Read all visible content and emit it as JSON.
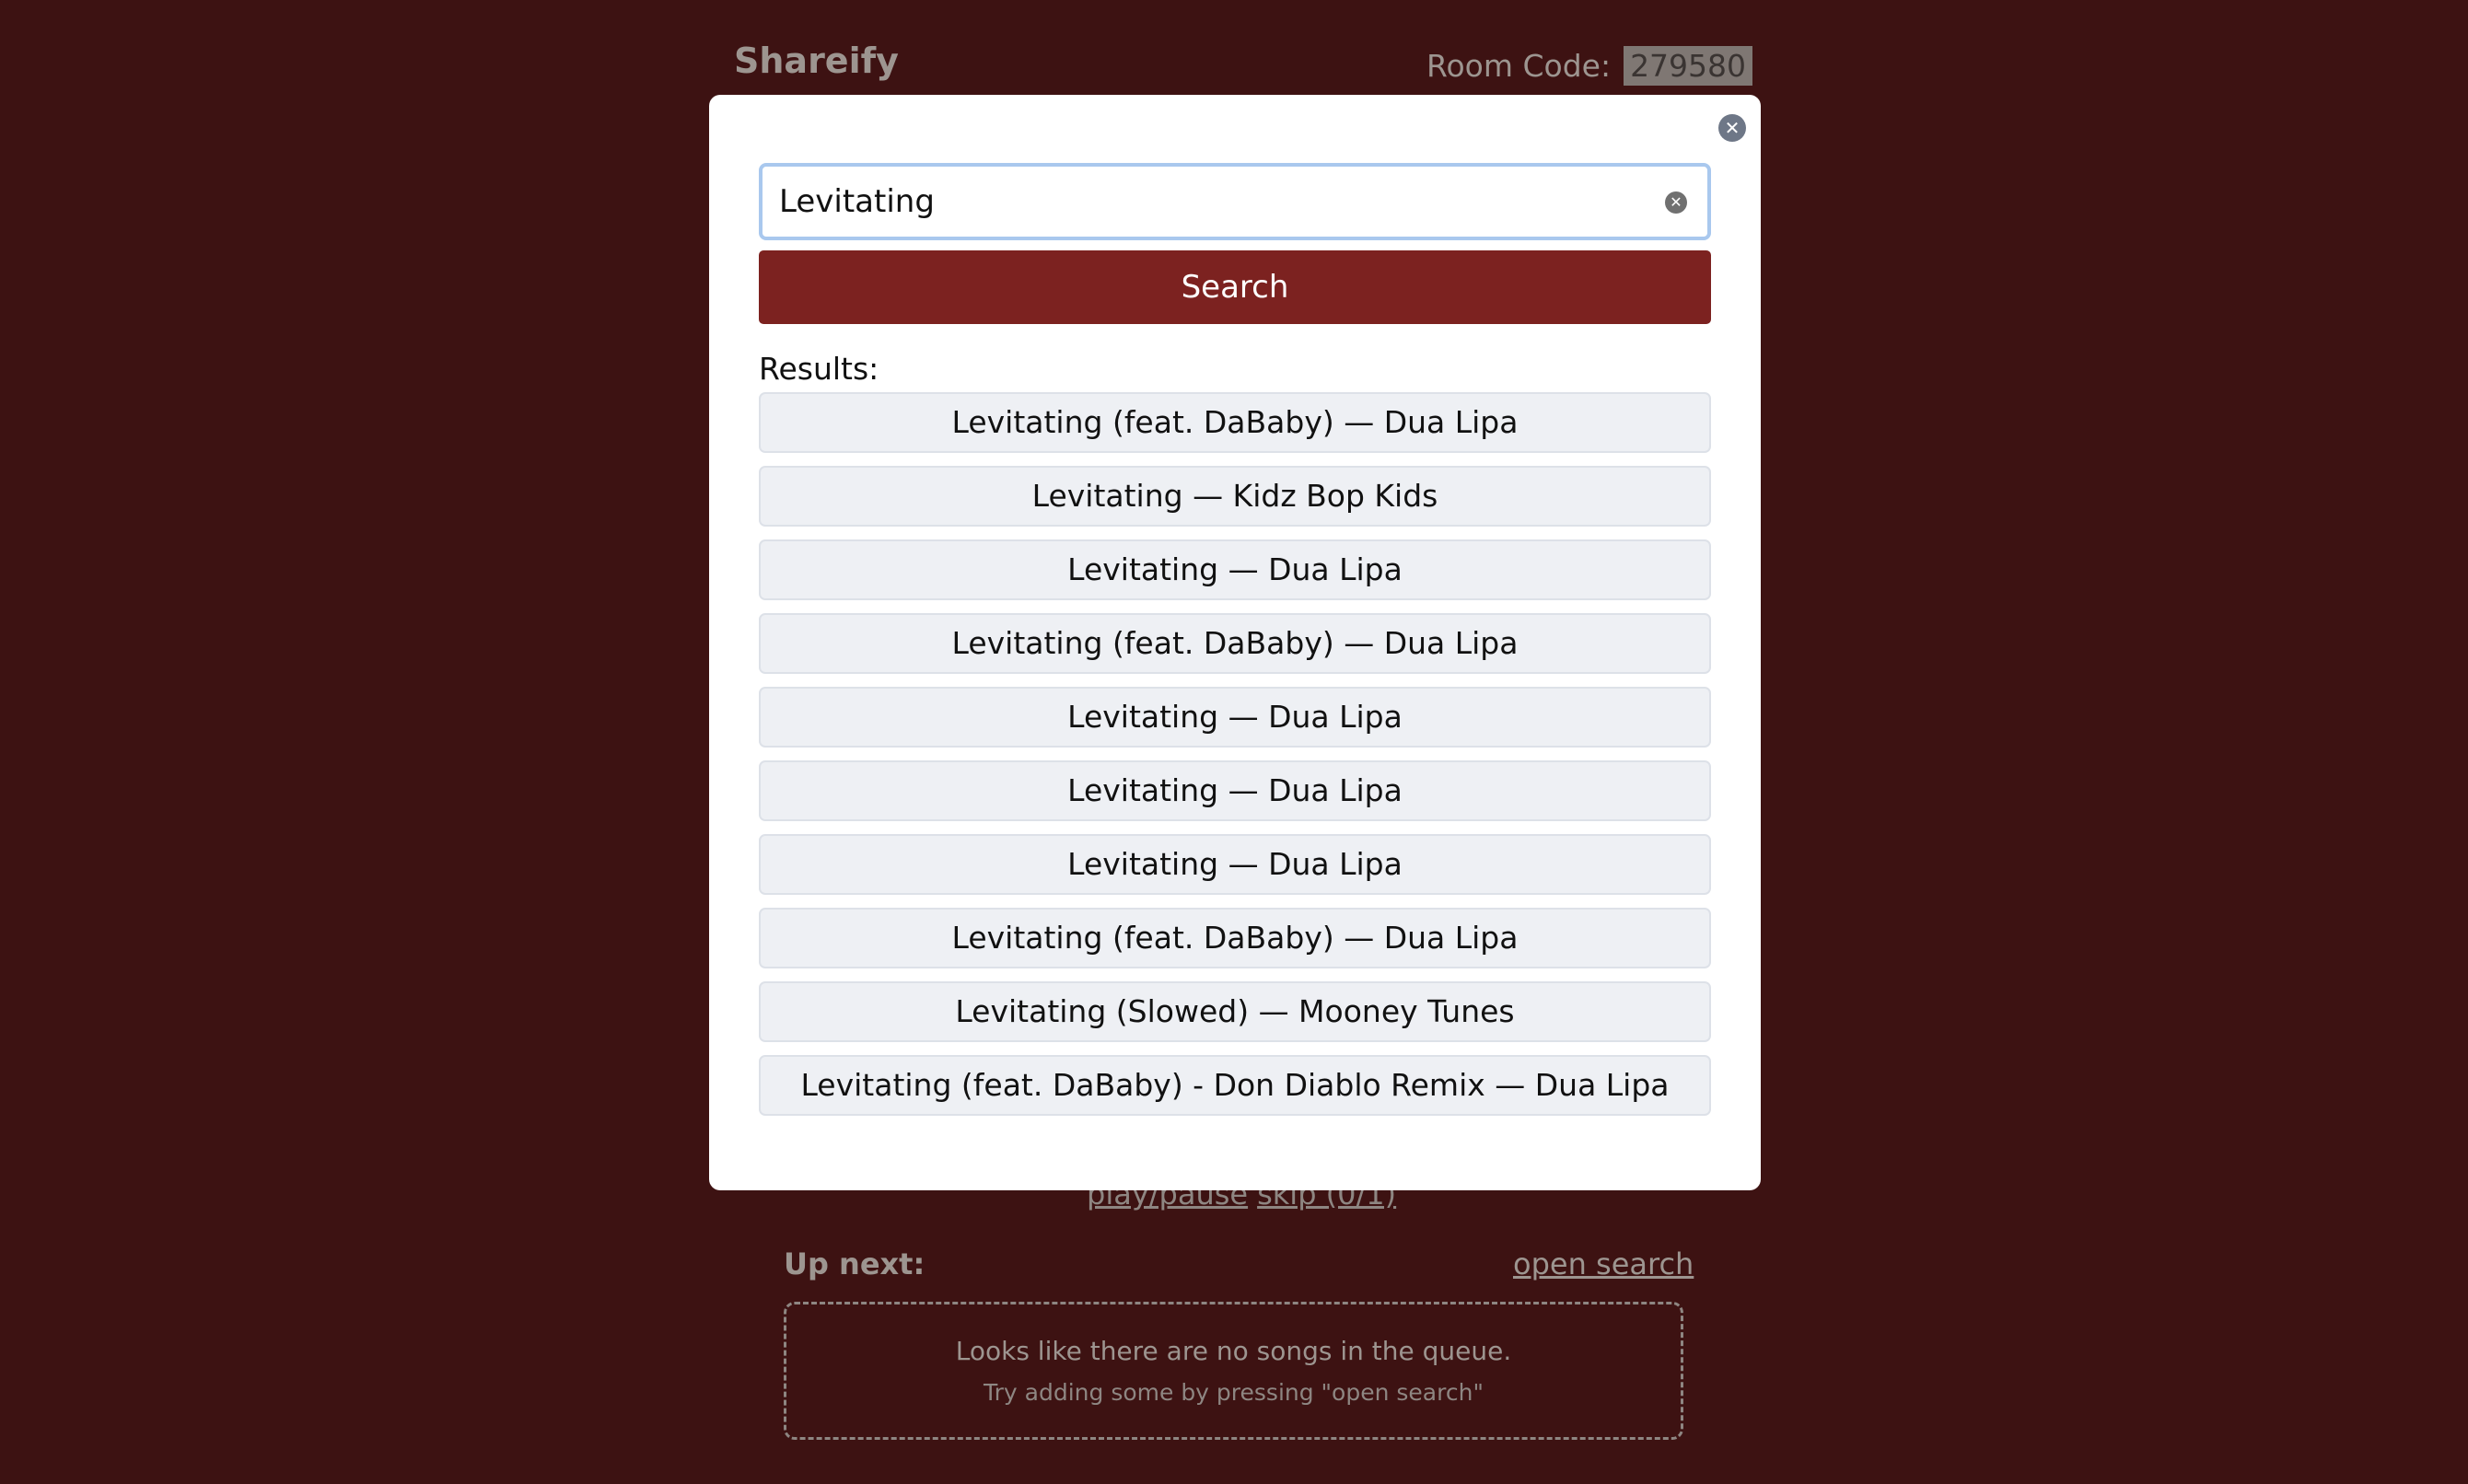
{
  "header": {
    "app_title": "Shareify",
    "room_code_label": "Room Code:",
    "room_code": "279580"
  },
  "player": {
    "play_pause": "play/pause",
    "skip": "skip (0/1)"
  },
  "queue": {
    "up_next_label": "Up next:",
    "open_search": "open search",
    "empty_message": "Looks like there are no songs in the queue.",
    "empty_hint": "Try adding some by pressing \"open search\""
  },
  "modal": {
    "close_icon": "close-icon",
    "search": {
      "value": "Levitating",
      "clear_icon": "clear-icon"
    },
    "search_button": "Search",
    "results_label": "Results:",
    "results": [
      "Levitating (feat. DaBaby) — Dua Lipa",
      "Levitating — Kidz Bop Kids",
      "Levitating — Dua Lipa",
      "Levitating (feat. DaBaby) — Dua Lipa",
      "Levitating — Dua Lipa",
      "Levitating — Dua Lipa",
      "Levitating — Dua Lipa",
      "Levitating (feat. DaBaby) — Dua Lipa",
      "Levitating (Slowed) — Mooney Tunes",
      "Levitating (feat. DaBaby) - Don Diablo Remix — Dua Lipa"
    ]
  },
  "colors": {
    "background": "#3d1212",
    "accent": "#7c2220",
    "modal": "#ffffff",
    "result_bg": "#eef0f4"
  }
}
